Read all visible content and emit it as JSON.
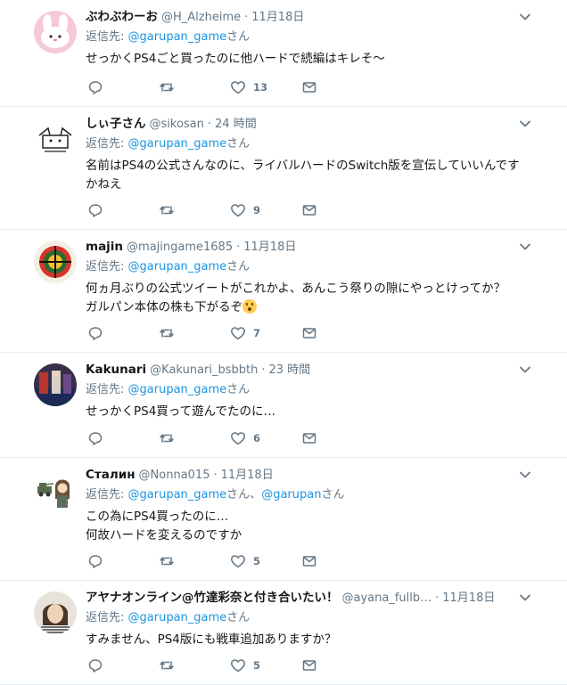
{
  "reply_prefix": "返信先:",
  "tweets": [
    {
      "name": "ぶわぶわーお",
      "handle": "@H_Alzheime",
      "dot": "·",
      "time": "11月18日",
      "reply_to": [
        {
          "link": "@garupan_game",
          "suffix": "さん"
        }
      ],
      "text_lines": [
        "せっかくPS4ごと買ったのに他ハードで続編はキレそ〜"
      ],
      "counts": {
        "reply": "",
        "retweet": "",
        "like": "13"
      }
    },
    {
      "name": "しぃ子さん",
      "handle": "@sikosan",
      "dot": "·",
      "time": "24 時間",
      "reply_to": [
        {
          "link": "@garupan_game",
          "suffix": "さん"
        }
      ],
      "text_lines": [
        "名前はPS4の公式さんなのに、ライバルハードのSwitch版を宣伝していいんです",
        "かねえ"
      ],
      "counts": {
        "reply": "",
        "retweet": "",
        "like": "9"
      }
    },
    {
      "name": "majin",
      "handle": "@majingame1685",
      "dot": "·",
      "time": "11月18日",
      "reply_to": [
        {
          "link": "@garupan_game",
          "suffix": "さん"
        }
      ],
      "text_lines": [
        "何ヵ月ぶりの公式ツイートがこれかよ、あんこう祭りの隙にやっとけってか？",
        "ガルパン本体の株も下がるぞ"
      ],
      "counts": {
        "reply": "",
        "retweet": "",
        "like": "7"
      }
    },
    {
      "name": "Kakunari",
      "handle": "@Kakunari_bsbbth",
      "dot": "·",
      "time": "23 時間",
      "reply_to": [
        {
          "link": "@garupan_game",
          "suffix": "さん"
        }
      ],
      "text_lines": [
        "せっかくPS4買って遊んでたのに…"
      ],
      "counts": {
        "reply": "",
        "retweet": "",
        "like": "6"
      }
    },
    {
      "name": "Сталин",
      "handle": "@Nonna015",
      "dot": "·",
      "time": "11月18日",
      "reply_to": [
        {
          "link": "@garupan_game",
          "suffix": "さん、"
        },
        {
          "link": "@garupan",
          "suffix": "さん"
        }
      ],
      "text_lines": [
        "この為にPS4買ったのに…",
        "何故ハードを変えるのですか"
      ],
      "counts": {
        "reply": "",
        "retweet": "",
        "like": "5"
      }
    },
    {
      "name": "アヤナオンライン@竹達彩奈と付き合いたい！",
      "handle": "@ayana_fullb…",
      "dot": "·",
      "time": "11月18日",
      "reply_to": [
        {
          "link": "@garupan_game",
          "suffix": "さん"
        }
      ],
      "text_lines": [
        "すみません、PS4版にも戦車追加ありますか？"
      ],
      "counts": {
        "reply": "",
        "retweet": "",
        "like": "5"
      }
    }
  ],
  "icons": {
    "reply": "reply-icon",
    "retweet": "retweet-icon",
    "like": "heart-icon",
    "dm": "envelope-icon",
    "caret": "chevron-down-icon"
  },
  "colors": {
    "link": "#1b95e0",
    "muted": "#657786",
    "text": "#14171a",
    "divider": "#e6ecf0"
  }
}
